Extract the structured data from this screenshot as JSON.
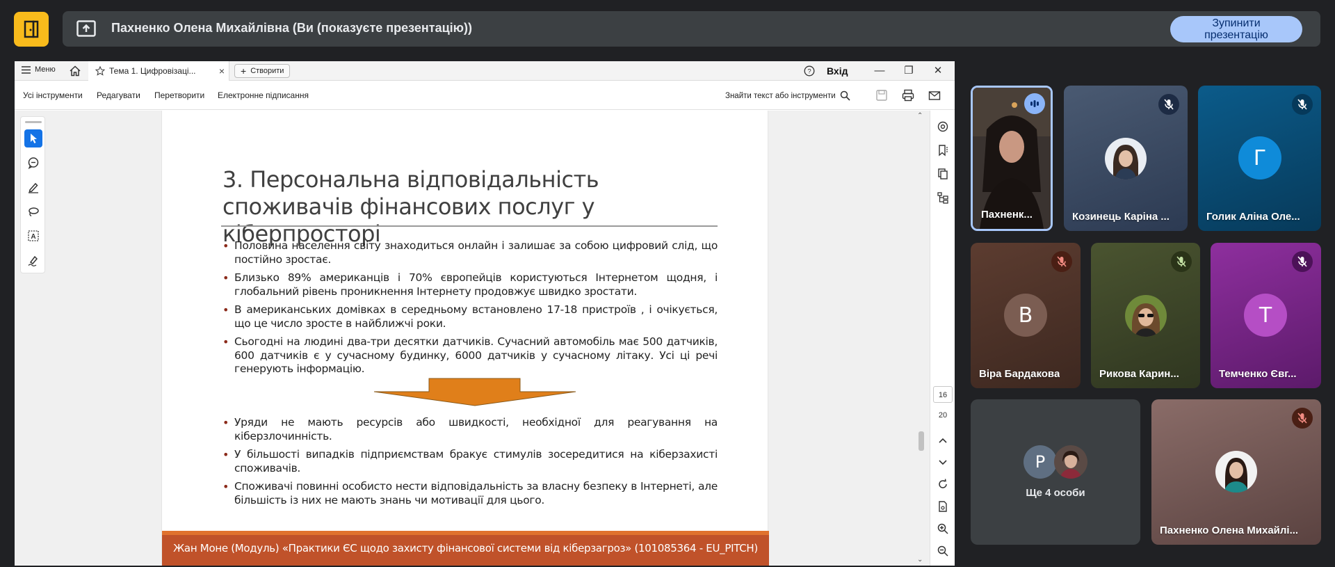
{
  "banner": {
    "presenter_title": "Пахненко Олена Михайлівна (Ви (показуєте презентацію))",
    "stop_button_label": "Зупинити\nпрезентацію"
  },
  "pdf_viewer": {
    "menu_label": "Меню",
    "tab_label": "Тема 1. Цифровізаці...",
    "create_label": "Створити",
    "login_label": "Вхід",
    "toolbar_items": [
      "Усі інструменти",
      "Редагувати",
      "Перетворити",
      "Електронне підписання"
    ],
    "search_label": "Знайти текст або інструменти",
    "page_numbers": [
      "16",
      "20"
    ]
  },
  "slide": {
    "title": "3. Персональна відповідальність споживачів фінансових послуг у кіберпросторі",
    "bullets_top": [
      "Половина населення світу знаходиться онлайн і залишає за собою цифровий слід, що постійно зростає.",
      "Близько 89% американців і 70% європейців користуються Інтернетом щодня, і глобальний рівень проникнення Інтернету продовжує швидко зростати.",
      "В американських домівках в середньому встановлено 17-18 пристроїв , і очікується, що це число зросте в найближчі роки.",
      "Сьогодні на людині два-три десятки датчиків. Сучасний автомобіль має 500 датчиків, 600 датчиків є у сучасному будинку, 6000 датчиків у сучасному літаку. Усі ці речі генерують інформацію."
    ],
    "bullets_bottom": [
      "Уряди не мають ресурсів або швидкості, необхідної для реагування на кіберзлочинність.",
      "У більшості випадків підприємствам бракує стимулів зосередитися на кіберзахисті споживачів.",
      "Споживачі повинні особисто нести відповідальність за власну безпеку в Інтернеті, але більшість із них не мають знань чи мотивації для цього."
    ],
    "footer": "Жан Моне (Модуль) «Практики ЄС щодо захисту фінансової системи від кіберзагроз» (101085364 - EU_PITCH)",
    "arrow_color": "#e07f1a",
    "footer_color": "#c0522a"
  },
  "participants": {
    "p1": "Пахненк...",
    "p2": "Козинець Каріна ...",
    "p3": "Голик Аліна Оле...",
    "p3_initial": "Г",
    "p4": "Віра Бардакова",
    "p4_initial": "В",
    "p5": "Рикова Карин...",
    "p6": "Темченко Євг...",
    "p6_initial": "Т",
    "more_label": "Ще 4 особи",
    "more_initial": "Р",
    "self": "Пахненко Олена Михайлі..."
  }
}
